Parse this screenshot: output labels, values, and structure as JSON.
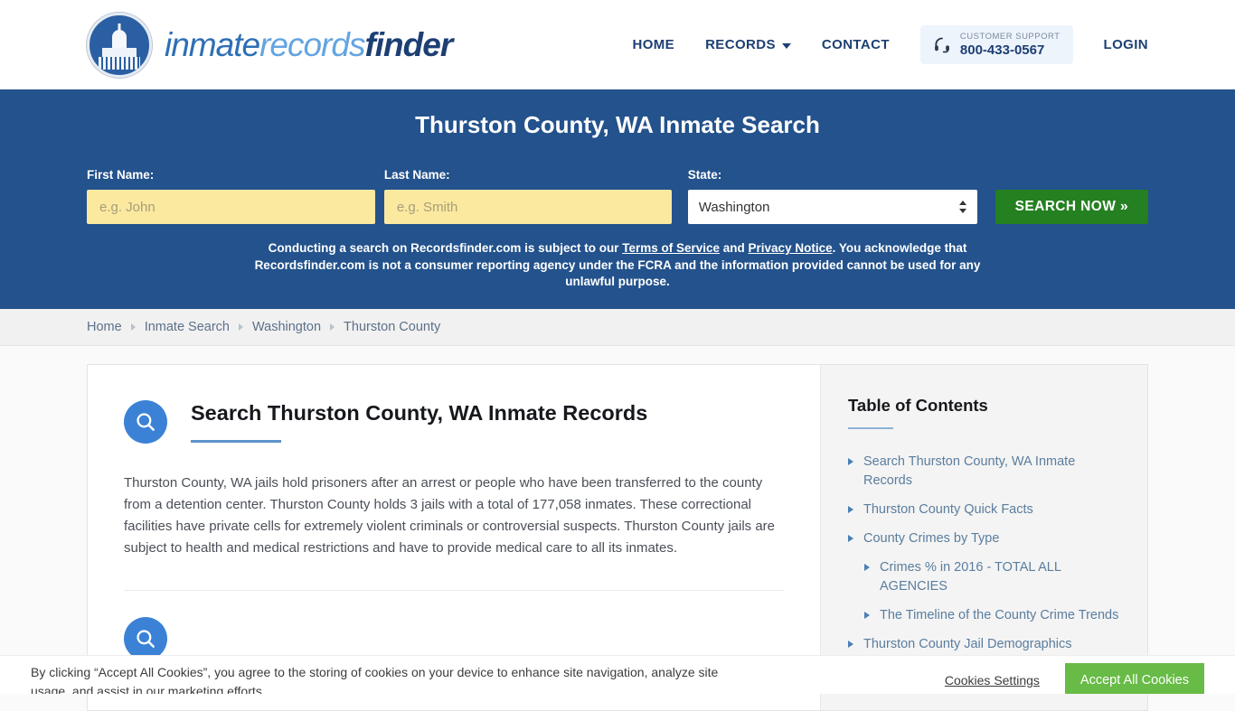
{
  "header": {
    "logo": {
      "part1": "inmate",
      "part2": "records",
      "part3": "finder",
      "seal_icon": "capitol-dome-icon"
    },
    "nav": [
      {
        "label": "HOME"
      },
      {
        "label": "RECORDS"
      },
      {
        "label": "CONTACT"
      }
    ],
    "support": {
      "icon": "headset-icon",
      "label": "CUSTOMER SUPPORT",
      "phone": "800-433-0567"
    },
    "login_label": "LOGIN"
  },
  "hero": {
    "title": "Thurston County, WA Inmate Search",
    "first_name_label": "First Name:",
    "first_name_placeholder": "e.g. John",
    "first_name_value": "",
    "last_name_label": "Last Name:",
    "last_name_placeholder": "e.g. Smith",
    "last_name_value": "",
    "state_label": "State:",
    "state_value": "Washington",
    "search_button": "SEARCH NOW »",
    "disclaimer": {
      "part1": "Conducting a search on Recordsfinder.com is subject to our ",
      "link1": "Terms of Service",
      "part2": " and ",
      "link2": "Privacy Notice",
      "part3": ". You acknowledge that Recordsfinder.com is not a consumer reporting agency under the FCRA and the information provided cannot be used for any unlawful purpose."
    }
  },
  "breadcrumb": [
    {
      "label": "Home"
    },
    {
      "label": "Inmate Search"
    },
    {
      "label": "Washington"
    },
    {
      "label": "Thurston County"
    }
  ],
  "main": {
    "section_icon": "search-circle-icon",
    "section_title": "Search Thurston County, WA Inmate Records",
    "paragraph": "Thurston County, WA jails hold prisoners after an arrest or people who have been transferred to the county from a detention center. Thurston County holds 3 jails with a total of 177,058 inmates. These correctional facilities have private cells for extremely violent criminals or controversial suspects. Thurston County jails are subject to health and medical restrictions and have to provide medical care to all its inmates."
  },
  "sidebar": {
    "title": "Table of Contents",
    "items": [
      {
        "label": "Search Thurston County, WA Inmate Records",
        "sub": false
      },
      {
        "label": "Thurston County Quick Facts",
        "sub": false
      },
      {
        "label": "County Crimes by Type",
        "sub": false
      },
      {
        "label": "Crimes % in 2016 - TOTAL ALL AGENCIES",
        "sub": true
      },
      {
        "label": "The Timeline of the County Crime Trends",
        "sub": true
      },
      {
        "label": "Thurston County Jail Demographics",
        "sub": false
      }
    ]
  },
  "cookie": {
    "text": "By clicking “Accept All Cookies”, you agree to the storing of cookies on your device to enhance site navigation, analyze site usage, and assist in our marketing efforts.",
    "settings_label": "Cookies Settings",
    "accept_label": "Accept All Cookies"
  },
  "colors": {
    "hero_blue": "#23528c",
    "brand_navy": "#1d3f73",
    "accent_blue": "#3b82d6",
    "search_green": "#248020",
    "cookie_green": "#68bb46",
    "input_yellow": "#fbe9a0"
  }
}
